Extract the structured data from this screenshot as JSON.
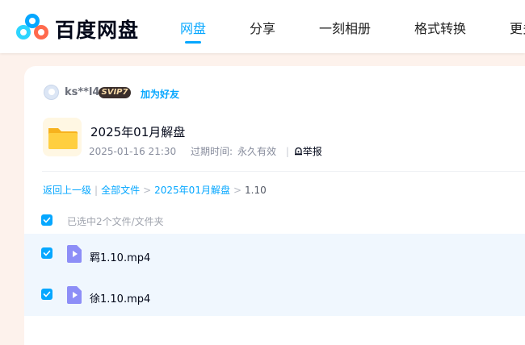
{
  "header": {
    "brand": "百度网盘",
    "nav": [
      "网盘",
      "分享",
      "一刻相册",
      "格式转换",
      "更多"
    ]
  },
  "share": {
    "username": "ks**l4",
    "vip": "SVIP7",
    "add_friend": "加为好友",
    "title": "2025年01月解盘",
    "date": "2025-01-16 21:30",
    "expiry_label": "过期时间:",
    "expiry_value": "永久有效",
    "report": "举报"
  },
  "breadcrumb": {
    "back": "返回上一级",
    "all_files": "全部文件",
    "folder": "2025年01月解盘",
    "current": "1.10"
  },
  "selection": {
    "text": "已选中2个文件/文件夹"
  },
  "files": [
    {
      "name": "羁1.10.mp4",
      "checked": true
    },
    {
      "name": "徐1.10.mp4",
      "checked": true
    }
  ],
  "colors": {
    "accent": "#06a7ff",
    "page_bg": "#fdf2ec",
    "row_selected": "#f0f7fe",
    "folder": "#ffc938",
    "video": "#8d8ef7"
  },
  "icons": [
    "baidu-netdisk-logo",
    "avatar",
    "folder-icon",
    "report-icon",
    "checkbox-checked-icon",
    "video-file-icon"
  ]
}
